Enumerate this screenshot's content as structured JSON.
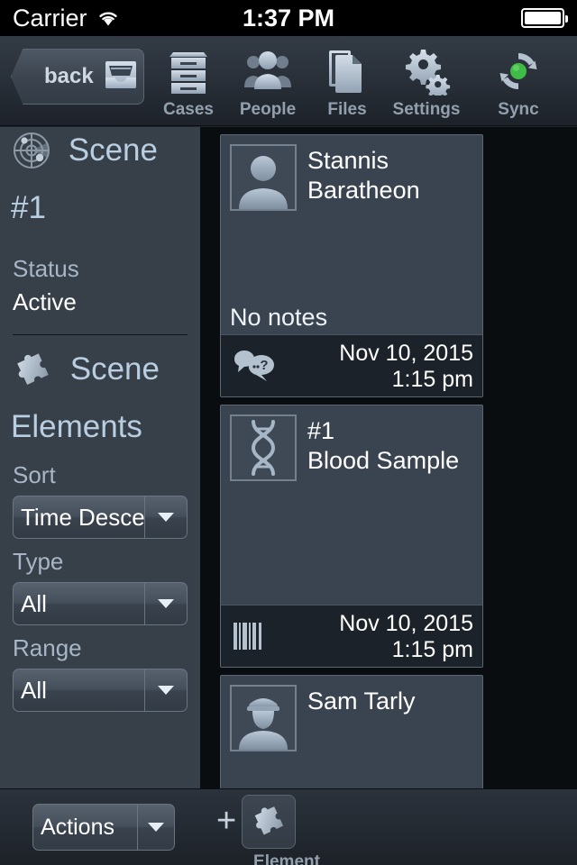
{
  "statusbar": {
    "carrier": "Carrier",
    "wifi_icon": "wifi-icon",
    "time": "1:37 PM",
    "battery_icon": "battery-full-icon"
  },
  "toolbar": {
    "back_label": "back",
    "back_icon": "file-tray-icon",
    "items": [
      {
        "label": "Cases",
        "icon": "file-cabinet-icon"
      },
      {
        "label": "People",
        "icon": "people-icon"
      },
      {
        "label": "Files",
        "icon": "documents-icon"
      },
      {
        "label": "Settings",
        "icon": "gears-icon"
      },
      {
        "label": "Sync",
        "icon": "sync-icon"
      }
    ]
  },
  "sidebar": {
    "scene_icon": "radar-scene-icon",
    "scene_title": "Scene #1",
    "status_label": "Status",
    "status_value": "Active",
    "elements_icon": "puzzle-piece-icon",
    "elements_title": "Scene Elements",
    "filters": [
      {
        "label": "Sort",
        "value": "Time Descending",
        "name": "sort"
      },
      {
        "label": "Type",
        "value": "All",
        "name": "type"
      },
      {
        "label": "Range",
        "value": "All",
        "name": "range"
      }
    ]
  },
  "content": {
    "cards": [
      {
        "name": "card-stannis-baratheon",
        "thumb_icon": "person-avatar-icon",
        "title": "Stannis Baratheon",
        "notes": "No notes",
        "footer_icon": "speech-bubbles-question-icon",
        "date": "Nov 10, 2015",
        "time": "1:15 pm"
      },
      {
        "name": "card-blood-sample",
        "thumb_icon": "dna-helix-icon",
        "title": "#1\nBlood Sample",
        "title_line1": "#1",
        "title_line2": "Blood Sample",
        "notes": "",
        "footer_icon": "barcode-icon",
        "date": "Nov 10, 2015",
        "time": "1:15 pm"
      },
      {
        "name": "card-sam-tarly",
        "thumb_icon": "officer-avatar-icon",
        "title": "Sam Tarly",
        "notes": "",
        "footer_icon": "",
        "date": "",
        "time": ""
      }
    ]
  },
  "bottombar": {
    "actions_label": "Actions",
    "add_plus": "+",
    "add_icon": "puzzle-piece-icon",
    "add_label": "Element"
  },
  "colors": {
    "accent_blue": "#b9cee0",
    "sidebar_bg": "#373f49",
    "card_bg": "#3a4450",
    "card_footer_bg": "#1b222a",
    "content_bg": "#0a0d10",
    "sync_green": "#3fbb47",
    "icon_silver": "#b4c2d0"
  }
}
